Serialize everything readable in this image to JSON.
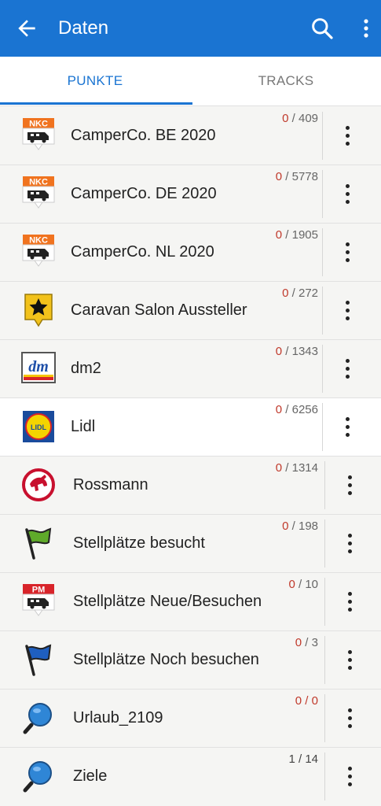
{
  "appbar": {
    "title": "Daten"
  },
  "tabs": [
    {
      "label": "PUNKTE"
    },
    {
      "label": "TRACKS"
    }
  ],
  "rows": [
    {
      "label": "CamperCo. BE 2020",
      "selected": "0",
      "total": " / 409",
      "icon": "nkc-camper-icon",
      "badge": "NKC"
    },
    {
      "label": "CamperCo. DE 2020",
      "selected": "0",
      "total": " / 5778",
      "icon": "nkc-camper-icon",
      "badge": "NKC"
    },
    {
      "label": "CamperCo. NL 2020",
      "selected": "0",
      "total": " / 1905",
      "icon": "nkc-camper-icon",
      "badge": "NKC"
    },
    {
      "label": "Caravan Salon Aussteller",
      "selected": "0",
      "total": " / 272",
      "icon": "star-icon"
    },
    {
      "label": "dm2",
      "selected": "0",
      "total": " / 1343",
      "icon": "dm-logo-icon",
      "badge": "dm"
    },
    {
      "label": "Lidl",
      "selected": "0",
      "total": " / 6256",
      "icon": "lidl-logo-icon",
      "badge": "LIDL"
    },
    {
      "label": "Rossmann",
      "selected": "0",
      "total": " / 1314",
      "icon": "rossmann-logo-icon"
    },
    {
      "label": "Stellplätze besucht",
      "selected": "0",
      "total": " / 198",
      "icon": "green-flag-icon"
    },
    {
      "label": "Stellplätze Neue/Besuchen",
      "selected": "0",
      "total": " / 10",
      "icon": "pm-camper-icon",
      "badge": "PM"
    },
    {
      "label": "Stellplätze Noch besuchen",
      "selected": "0",
      "total": " / 3",
      "icon": "blue-flag-icon"
    },
    {
      "label": "Urlaub_2109",
      "selected": "0",
      "total": " / 0",
      "icon": "magnifier-pin-icon"
    },
    {
      "label": "Ziele",
      "selected": "1",
      "total": " / 14",
      "icon": "magnifier-pin-icon"
    }
  ],
  "colors": {
    "primary": "#1a74d2",
    "count_selected": "#c0392b"
  }
}
